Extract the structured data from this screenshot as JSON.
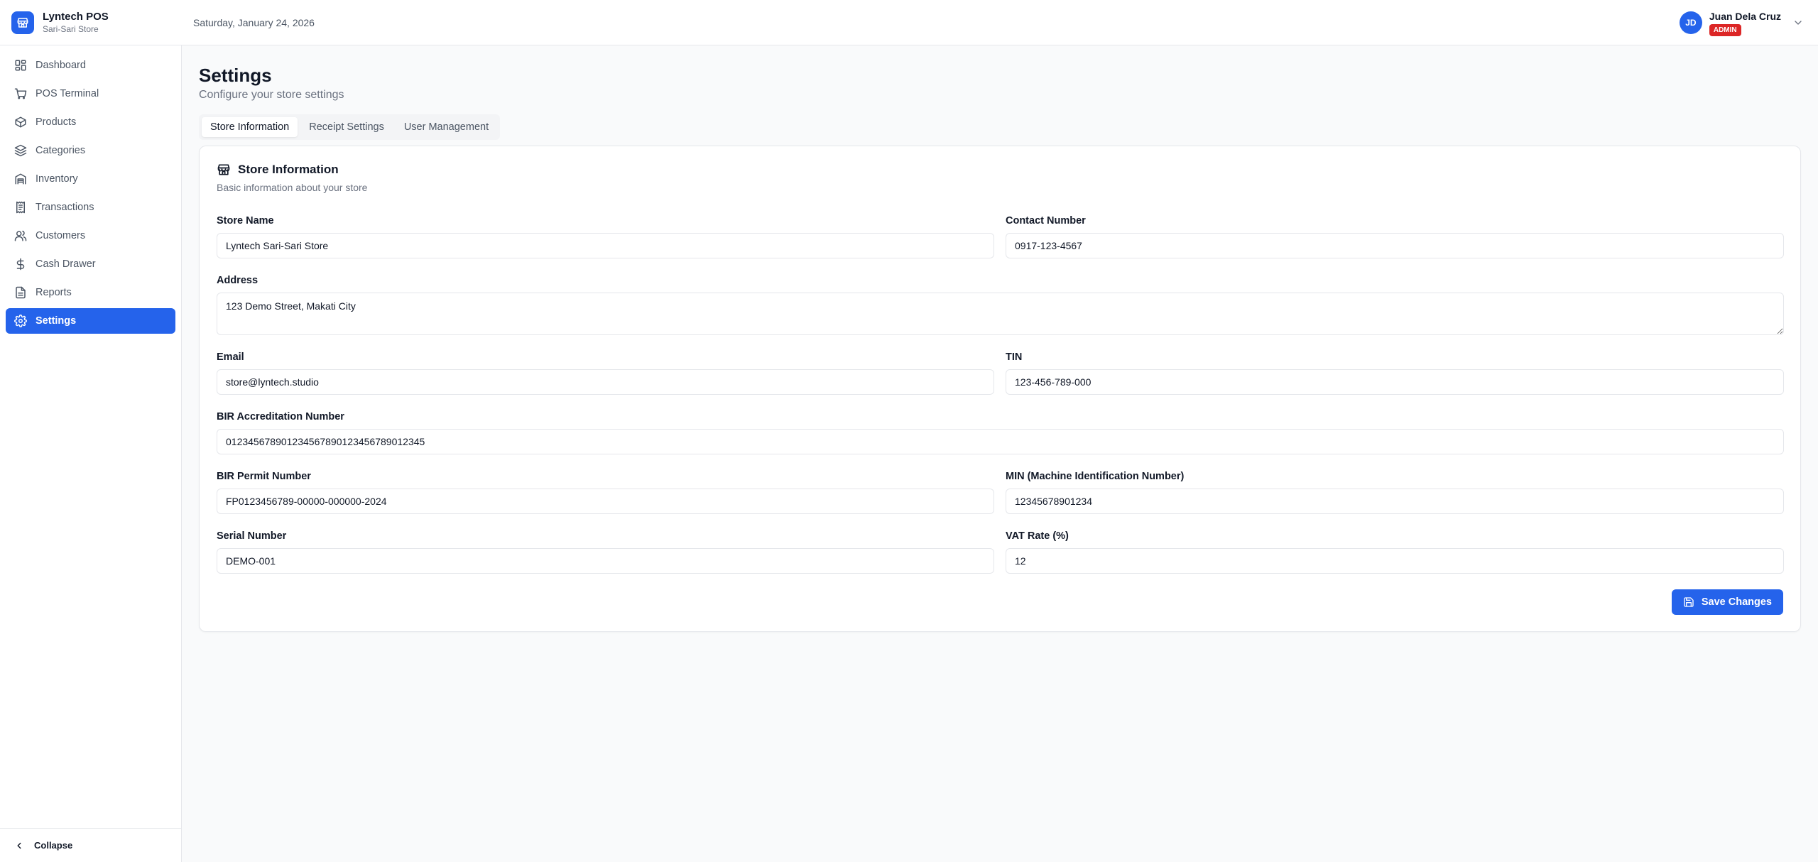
{
  "app": {
    "name": "Lyntech POS",
    "store": "Sari-Sari Store",
    "accent": "#2563eb"
  },
  "header": {
    "date": "Saturday, January 24, 2026"
  },
  "user": {
    "initials": "JD",
    "name": "Juan Dela Cruz",
    "role": "ADMIN",
    "role_color": "#dc2626"
  },
  "sidebar": {
    "items": [
      {
        "label": "Dashboard",
        "icon": "dashboard-icon"
      },
      {
        "label": "POS Terminal",
        "icon": "cart-icon"
      },
      {
        "label": "Products",
        "icon": "package-icon"
      },
      {
        "label": "Categories",
        "icon": "layers-icon"
      },
      {
        "label": "Inventory",
        "icon": "warehouse-icon"
      },
      {
        "label": "Transactions",
        "icon": "receipt-icon"
      },
      {
        "label": "Customers",
        "icon": "users-icon"
      },
      {
        "label": "Cash Drawer",
        "icon": "dollar-icon"
      },
      {
        "label": "Reports",
        "icon": "file-icon"
      },
      {
        "label": "Settings",
        "icon": "gear-icon",
        "active": true
      }
    ],
    "collapse_label": "Collapse"
  },
  "page": {
    "title": "Settings",
    "subtitle": "Configure your store settings"
  },
  "tabs": [
    {
      "label": "Store Information",
      "active": true
    },
    {
      "label": "Receipt Settings"
    },
    {
      "label": "User Management"
    }
  ],
  "card": {
    "title": "Store Information",
    "description": "Basic information about your store",
    "fields": {
      "store_name": {
        "label": "Store Name",
        "value": "Lyntech Sari-Sari Store"
      },
      "contact_number": {
        "label": "Contact Number",
        "value": "0917-123-4567"
      },
      "address": {
        "label": "Address",
        "value": "123 Demo Street, Makati City"
      },
      "email": {
        "label": "Email",
        "value": "store@lyntech.studio"
      },
      "tin": {
        "label": "TIN",
        "value": "123-456-789-000"
      },
      "bir_accreditation": {
        "label": "BIR Accreditation Number",
        "value": "012345678901234567890123456789012345"
      },
      "bir_permit": {
        "label": "BIR Permit Number",
        "value": "FP0123456789-00000-000000-2024"
      },
      "min": {
        "label": "MIN (Machine Identification Number)",
        "value": "12345678901234"
      },
      "serial_number": {
        "label": "Serial Number",
        "value": "DEMO-001"
      },
      "vat_rate": {
        "label": "VAT Rate (%)",
        "value": "12"
      }
    },
    "save_label": "Save Changes"
  }
}
